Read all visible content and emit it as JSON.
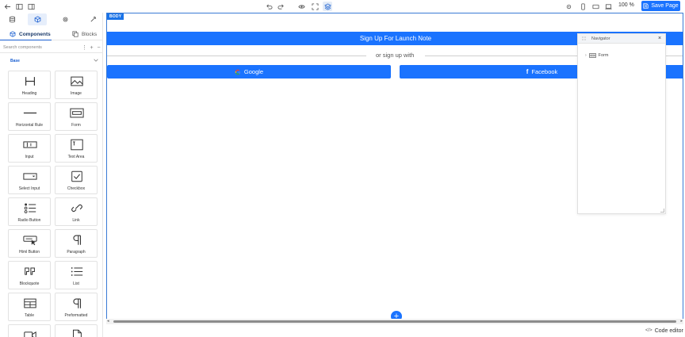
{
  "topbar": {
    "zoom": "100 %",
    "save_label": "Save Page"
  },
  "left_panel": {
    "tabs": [
      {
        "label": "Components",
        "icon": "cube-icon"
      },
      {
        "label": "Blocks",
        "icon": "blocks-icon"
      }
    ],
    "search": {
      "placeholder": "Search components",
      "value": ""
    },
    "section": {
      "label": "Base"
    },
    "components": [
      {
        "label": "Heading",
        "icon": "heading-icon"
      },
      {
        "label": "Image",
        "icon": "image-icon"
      },
      {
        "label": "Horizontal Rule",
        "icon": "horizontal-rule-icon"
      },
      {
        "label": "Form",
        "icon": "form-icon"
      },
      {
        "label": "Input",
        "icon": "input-icon"
      },
      {
        "label": "Text Area",
        "icon": "text-area-icon"
      },
      {
        "label": "Select Input",
        "icon": "select-input-icon"
      },
      {
        "label": "Checkbox",
        "icon": "checkbox-icon"
      },
      {
        "label": "Radio Button",
        "icon": "radio-button-icon"
      },
      {
        "label": "Link",
        "icon": "link-icon"
      },
      {
        "label": "Html Button",
        "icon": "html-button-icon"
      },
      {
        "label": "Paragraph",
        "icon": "paragraph-icon"
      },
      {
        "label": "Blockquote",
        "icon": "blockquote-icon"
      },
      {
        "label": "List",
        "icon": "list-icon"
      },
      {
        "label": "Table",
        "icon": "table-icon"
      },
      {
        "label": "Preformatted",
        "icon": "preformatted-icon"
      },
      {
        "label": "",
        "icon": "video-icon"
      },
      {
        "label": "",
        "icon": "file-icon"
      }
    ]
  },
  "canvas": {
    "body_badge": "BODY",
    "signup_label": "Sign Up For Launch Note",
    "separator_text": "or sign up with",
    "google_label": "Google",
    "facebook_label": "Facebook",
    "add_label": "+"
  },
  "navigator": {
    "title": "Navigator",
    "close": "×",
    "items": [
      {
        "label": "Form",
        "icon": "form-icon"
      }
    ]
  },
  "footer": {
    "code_editor_label": "Code editor"
  },
  "colors": {
    "accent": "#1a73ff",
    "canvas_border": "#3a7bd5"
  }
}
